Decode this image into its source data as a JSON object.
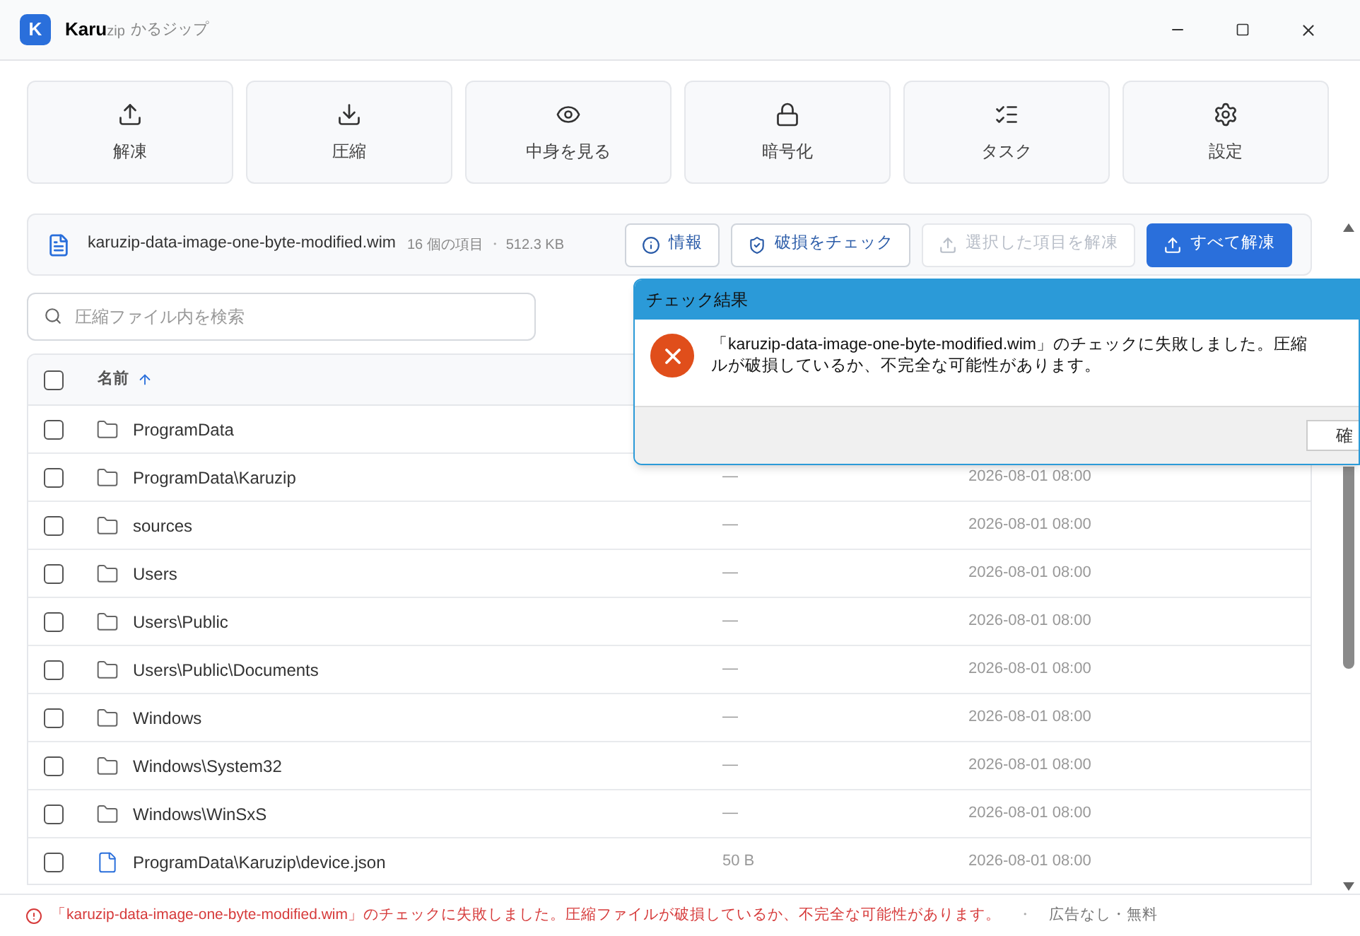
{
  "window": {
    "logo": "K",
    "title_main": "Karu",
    "title_sub": "zip",
    "title_kana": "かるジップ"
  },
  "toolbar": [
    {
      "kind": "extract",
      "label": "解凍"
    },
    {
      "kind": "compress",
      "label": "圧縮"
    },
    {
      "kind": "view",
      "label": "中身を見る"
    },
    {
      "kind": "encrypt",
      "label": "暗号化"
    },
    {
      "kind": "tasks",
      "label": "タスク"
    },
    {
      "kind": "settings",
      "label": "設定"
    }
  ],
  "archive": {
    "name": "karuzip-data-image-one-byte-modified.wim",
    "count": "16 個の項目",
    "separator": "・",
    "size": "512.3 KB",
    "actions": [
      {
        "kind": "info",
        "label": "情報",
        "disabled": false,
        "primary": false
      },
      {
        "kind": "check",
        "label": "破損をチェック",
        "disabled": false,
        "primary": false
      },
      {
        "kind": "extract",
        "label": "選択した項目を解凍",
        "disabled": true,
        "primary": false
      },
      {
        "kind": "extract",
        "label": "すべて解凍",
        "disabled": false,
        "primary": true
      }
    ]
  },
  "search": {
    "placeholder": "圧縮ファイル内を検索"
  },
  "table": {
    "header_checked": false,
    "columns": [
      {
        "label": "名前",
        "sorted": true
      }
    ],
    "rows": [
      {
        "kind": "folder",
        "name": "ProgramData",
        "checked": false
      },
      {
        "kind": "folder",
        "name": "ProgramData\\Karuzip",
        "size": "—",
        "date": "2026-08-01 08:00",
        "checked": false
      },
      {
        "kind": "folder",
        "name": "sources",
        "size": "—",
        "date": "2026-08-01 08:00",
        "checked": false
      },
      {
        "kind": "folder",
        "name": "Users",
        "size": "—",
        "date": "2026-08-01 08:00",
        "checked": false
      },
      {
        "kind": "folder",
        "name": "Users\\Public",
        "size": "—",
        "date": "2026-08-01 08:00",
        "checked": false
      },
      {
        "kind": "folder",
        "name": "Users\\Public\\Documents",
        "size": "—",
        "date": "2026-08-01 08:00",
        "checked": false
      },
      {
        "kind": "folder",
        "name": "Windows",
        "size": "—",
        "date": "2026-08-01 08:00",
        "checked": false
      },
      {
        "kind": "folder",
        "name": "Windows\\System32",
        "size": "—",
        "date": "2026-08-01 08:00",
        "checked": false
      },
      {
        "kind": "folder",
        "name": "Windows\\WinSxS",
        "size": "—",
        "date": "2026-08-01 08:00",
        "checked": false
      },
      {
        "kind": "file",
        "name": "ProgramData\\Karuzip\\device.json",
        "size": "50 B",
        "date": "2026-08-01 08:00",
        "checked": false
      }
    ]
  },
  "dialog": {
    "title": "チェック結果",
    "message_lines": [
      "「karuzip-data-image-one-byte-modified.wim」のチェックに失敗しました。圧縮",
      "ルが破損しているか、不完全な可能性があります。"
    ],
    "button": "確"
  },
  "status_bar": {
    "message": "「karuzip-data-image-one-byte-modified.wim」のチェックに失敗しました。圧縮ファイルが破損しているか、不完全な可能性があります。",
    "separator": "・",
    "note": "広告なし・無料"
  }
}
